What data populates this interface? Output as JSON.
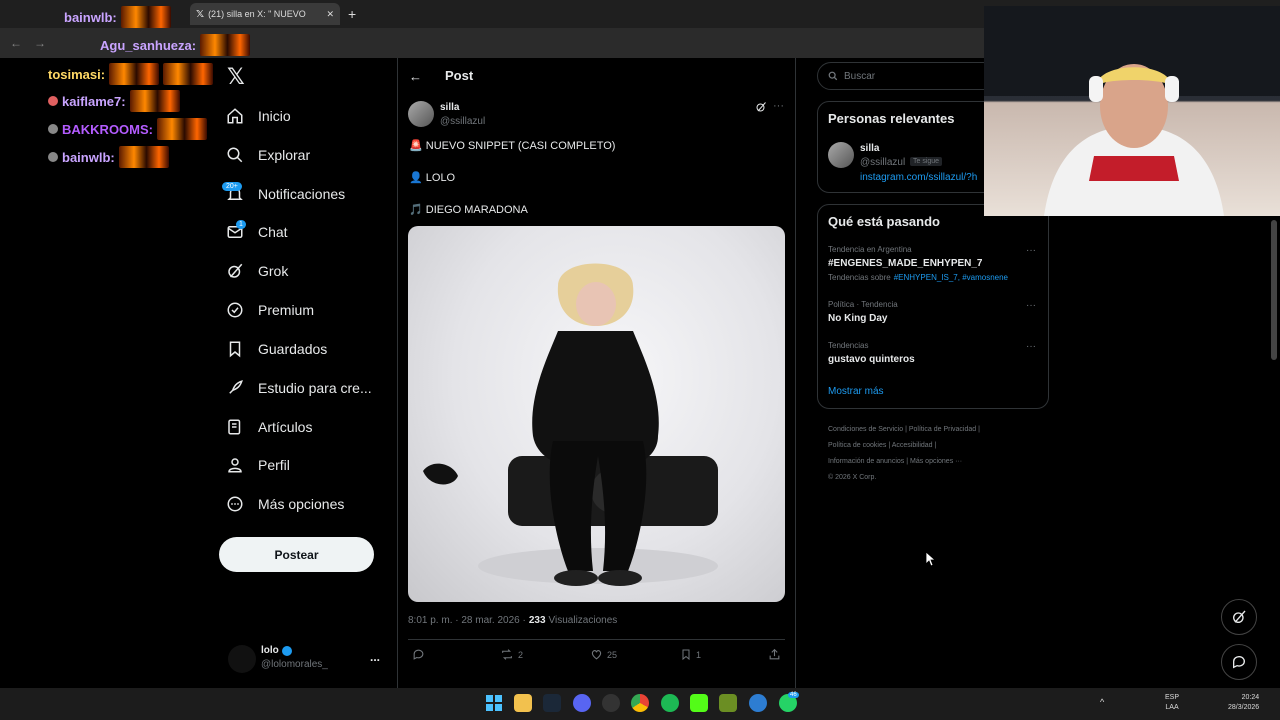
{
  "browser": {
    "tab_title": "(21) silla en X: \" NUEVO",
    "new_tab": "+"
  },
  "overlay_chat": [
    {
      "user": "bainwlb:"
    },
    {
      "user": "Agu_sanhueza:"
    },
    {
      "user": "tosimasi:"
    },
    {
      "user": "kaiflame7:"
    },
    {
      "user": "BAKKROOMS:"
    },
    {
      "user": "bainwlb:"
    }
  ],
  "sidebar": {
    "items": [
      {
        "label": "Inicio"
      },
      {
        "label": "Explorar"
      },
      {
        "label": "Notificaciones",
        "badge": "20+"
      },
      {
        "label": "Chat",
        "badge": "1"
      },
      {
        "label": "Grok"
      },
      {
        "label": "Premium"
      },
      {
        "label": "Guardados"
      },
      {
        "label": "Estudio para cre..."
      },
      {
        "label": "Artículos"
      },
      {
        "label": "Perfil"
      },
      {
        "label": "Más opciones"
      }
    ],
    "post_button": "Postear",
    "account": {
      "name": "lolo",
      "handle": "@lolomorales_",
      "more": "..."
    }
  },
  "main": {
    "header": "Post",
    "author": {
      "name": "silla",
      "handle": "@ssillazul"
    },
    "lines": [
      "NUEVO SNIPPET (CASI COMPLETO)",
      "LOLO",
      "DIEGO MARADONA"
    ],
    "line_emojis": [
      "🚨",
      "👤",
      "🎵"
    ],
    "time": "8:01 p. m. · 28 mar. 2026 ·",
    "views_count": "233",
    "views_label": "Visualizaciones",
    "actions": {
      "retweets": "2",
      "likes": "25",
      "bookmarks": "1"
    }
  },
  "right": {
    "search_placeholder": "Buscar",
    "relevant_title": "Personas relevantes",
    "relevant_user": {
      "name": "silla",
      "handle": "@ssillazul",
      "follows_you": "Te sigue",
      "link": "instagram.com/ssillazul/?h"
    },
    "trending_title": "Qué está pasando",
    "trends": [
      {
        "context": "Tendencia en Argentina",
        "name": "#ENGENES_MADE_ENHYPEN_7",
        "sub_prefix": "Tendencias sobre",
        "sub_tags": "#ENHYPEN_IS_7, #vamosnene"
      },
      {
        "context": "Política · Tendencia",
        "name": "No King Day"
      },
      {
        "context": "Tendencias",
        "name": "gustavo quinteros"
      }
    ],
    "show_more": "Mostrar más",
    "footer": [
      "Condiciones de Servicio",
      "|",
      "Política de Privacidad",
      "|",
      "Política de cookies",
      "|",
      "Accesibilidad",
      "|",
      "Información de anuncios",
      "|",
      "Más opciones ···",
      "© 2026 X Corp."
    ]
  },
  "taskbar": {
    "lang": "ESP",
    "lang2": "LAA",
    "time": "20:24",
    "date": "28/3/2026",
    "badge": "46"
  },
  "colors": {
    "accent": "#1d9bf0",
    "bg": "#000000",
    "border": "#2f3336"
  }
}
